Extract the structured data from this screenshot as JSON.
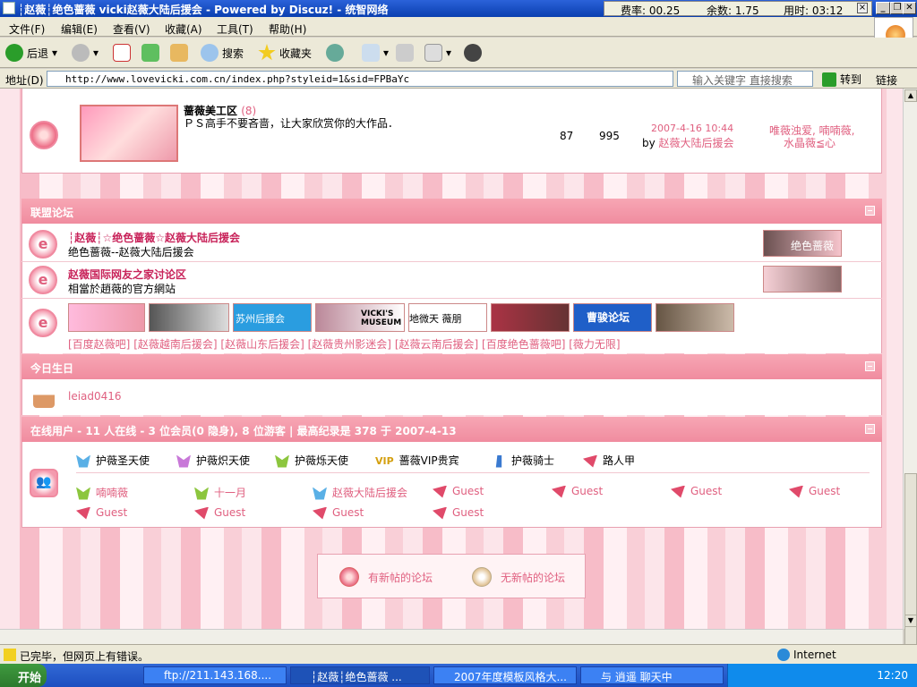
{
  "window": {
    "title": "┆赵薇┆绝色蔷薇  vicki赵薇大陆后援会 - Powered by Discuz! - 统智网络",
    "rate_label": "费率: 00.25",
    "balance_label": "余数: 1.75",
    "time_label": "用时: 03:12"
  },
  "menu": [
    "文件(F)",
    "编辑(E)",
    "查看(V)",
    "收藏(A)",
    "工具(T)",
    "帮助(H)"
  ],
  "toolbar": {
    "back": "后退",
    "search": "搜索",
    "favorites": "收藏夹"
  },
  "address": {
    "label": "地址(D)",
    "url": "http://www.lovevicki.com.cn/index.php?styleid=1&sid=FPBaYc",
    "search_placeholder": "输入关键字 直接搜索",
    "go": "转到",
    "links": "链接"
  },
  "forum_top": {
    "name": "蔷薇美工区",
    "count": "(8)",
    "desc": "ＰＳ高手不要吝啬，让大家欣赏你的大作品．",
    "topics": "87",
    "posts": "995",
    "last_date": "2007-4-16 10:44",
    "last_by_prefix": "by",
    "last_by": "赵薇大陆后援会",
    "mods": "唯薇浊爱, 喃喃薇,",
    "mods2": "水晶薇≦心"
  },
  "alliance": {
    "header": "联盟论坛",
    "items": [
      {
        "name": "┆赵薇┆☆绝色蔷薇☆赵薇大陆后援会",
        "desc": "绝色蔷薇--赵薇大陆后援会",
        "banner": "绝色蔷薇"
      },
      {
        "name": "赵薇国际网友之家讨论区",
        "desc": "相當於趙薇的官方網站"
      }
    ],
    "banners": [
      "",
      "",
      "苏州后援会",
      "VICKI'S MUSEUM",
      "地微天 薇朋",
      "",
      "曹骏论坛",
      ""
    ],
    "links": [
      "[百度赵薇吧]",
      "[赵薇越南后援会]",
      "[赵薇山东后援会]",
      "[赵薇贵州影迷会]",
      "[赵薇云南后援会]",
      "[百度绝色蔷薇吧]",
      "[薇力无限]"
    ]
  },
  "birthday": {
    "header": "今日生日",
    "user": "leiad0416"
  },
  "online": {
    "header": "在线用户 - 11 人在线 - 3 位会员(0 隐身), 8 位游客 | 最高纪录是 378 于 2007-4-13",
    "legend": [
      "护薇圣天使",
      "护薇炽天使",
      "护薇烁天使",
      "蔷薇VIP贵宾",
      "护薇骑士",
      "路人甲"
    ],
    "legend_vip": "VIP",
    "users": [
      "喃喃薇",
      "十一月",
      "赵薇大陆后援会",
      "Guest",
      "Guest",
      "Guest",
      "Guest",
      "Guest",
      "Guest",
      "Guest",
      "Guest"
    ]
  },
  "legend_box": {
    "new": "有新帖的论坛",
    "nonew": "无新帖的论坛"
  },
  "status": {
    "text": "已完毕，但网页上有错误。",
    "zone": "Internet"
  },
  "taskbar": {
    "start": "开始",
    "tasks": [
      "ftp://211.143.168....",
      "┆赵薇┆绝色蔷薇 ...",
      "2007年度模板风格大...",
      "与 逍遥 聊天中"
    ],
    "clock": "12:20"
  },
  "colors": {
    "header_pink": "#f08c9f",
    "link_pink": "#e06080",
    "title_blue": "#0a3fb0"
  }
}
